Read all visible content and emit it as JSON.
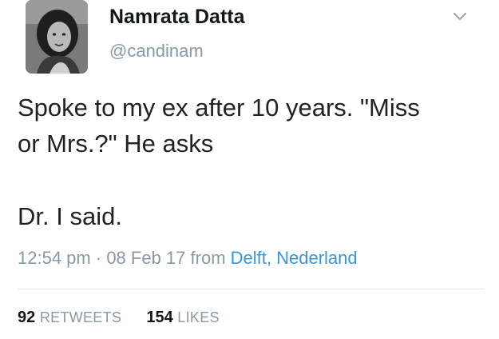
{
  "author": {
    "name": "Namrata Datta",
    "handle": "@candinam"
  },
  "tweet": {
    "lines": [
      "Spoke to my ex after 10 years. \"Miss",
      "or Mrs.?\" He asks",
      "Dr. I said."
    ],
    "time": "12:54 pm",
    "separator": "·",
    "date": "08 Feb 17",
    "from_label": "from",
    "location": "Delft, Nederland"
  },
  "stats": {
    "retweets_count": "92",
    "retweets_label": "RETWEETS",
    "likes_count": "154",
    "likes_label": "LIKES"
  },
  "icons": {
    "menu": "chevron-down-icon"
  },
  "colors": {
    "secondary_text": "#8899a6",
    "link": "#3b94d9",
    "divider": "#e1e8ed"
  }
}
